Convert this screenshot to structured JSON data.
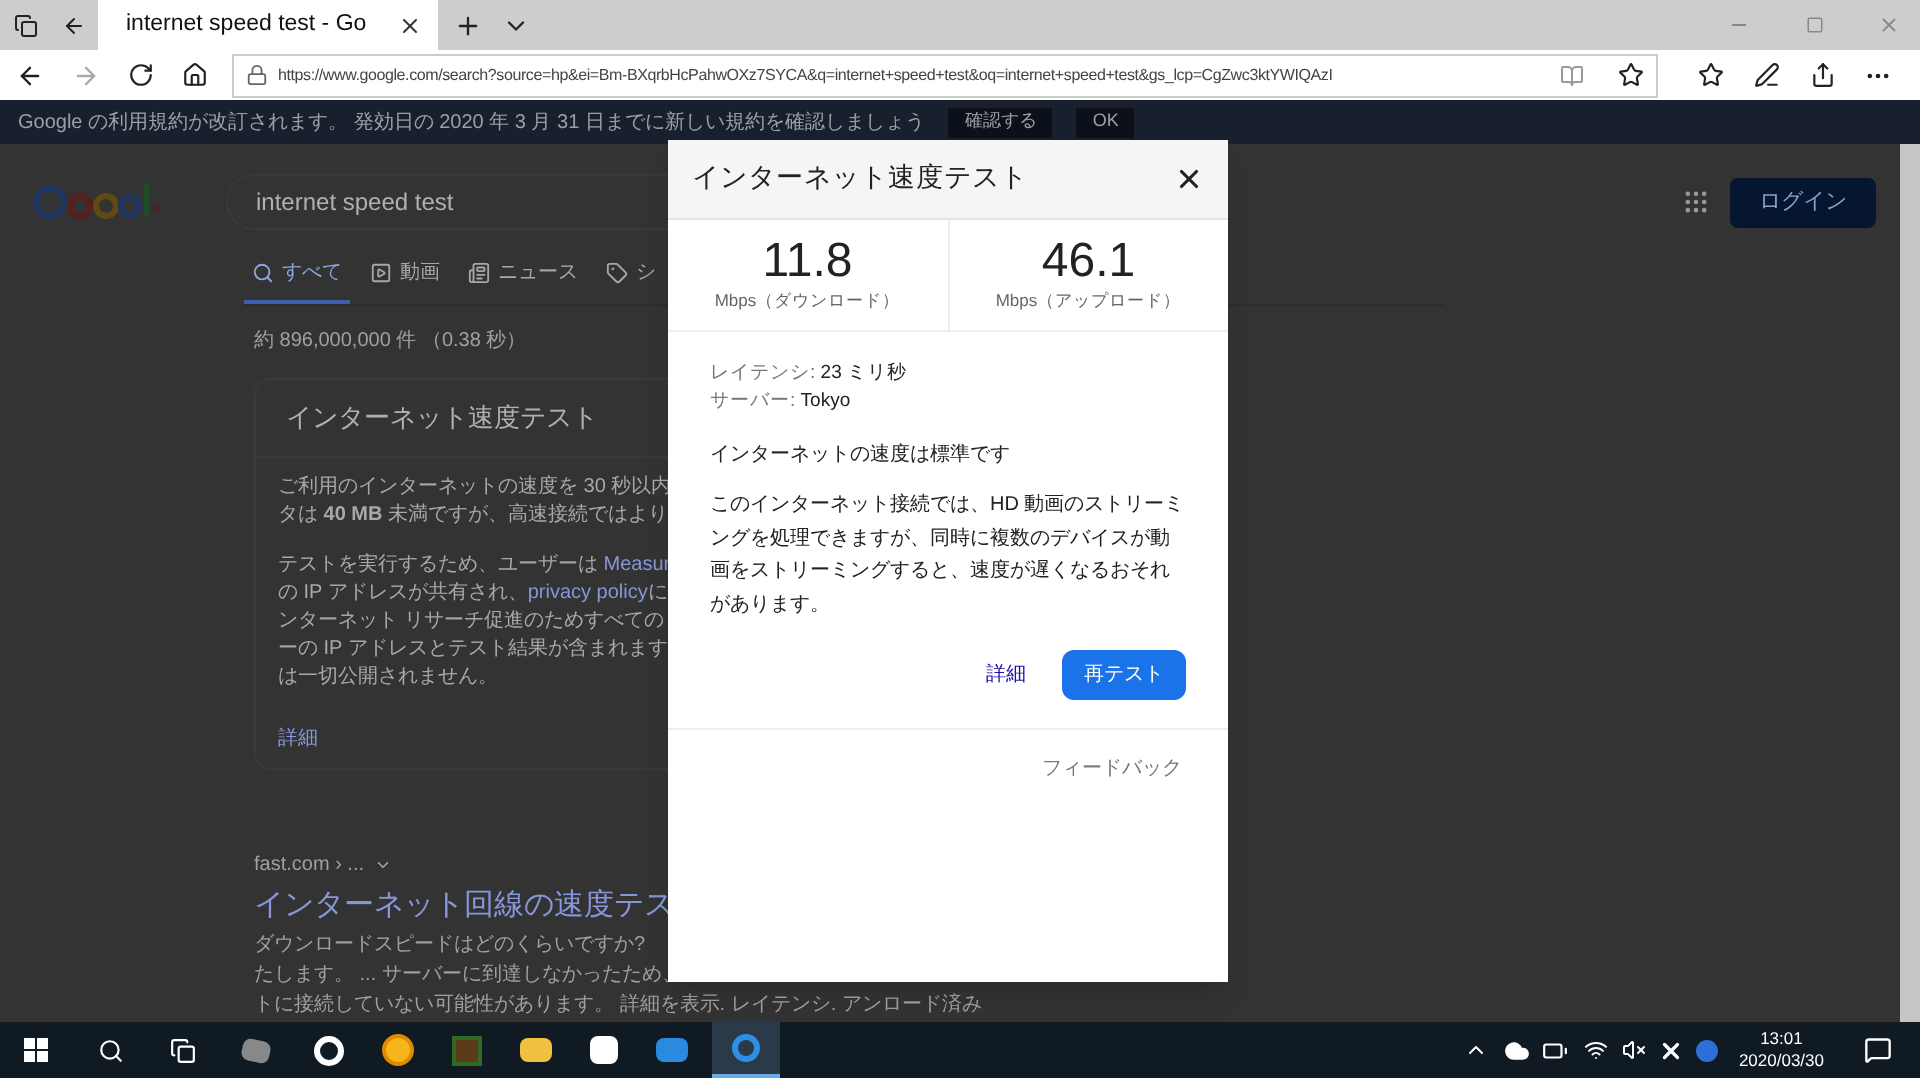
{
  "browser": {
    "tab_title": "internet speed test - Go",
    "url": "https://www.google.com/search?source=hp&ei=Bm-BXqrbHcPahwOXz7SYCA&q=internet+speed+test&oq=internet+speed+test&gs_lcp=CgZwc3ktYWIQAzI"
  },
  "banner": {
    "text": "Google の利用規約が改訂されます。 発効日の 2020 年 3 月 31 日までに新しい規約を確認しましょう",
    "buttons": [
      "確認する",
      "OK"
    ]
  },
  "search": {
    "query": "internet speed test",
    "login": "ログイン"
  },
  "search_tabs": [
    {
      "label": "すべて",
      "selected": true,
      "kind": "search"
    },
    {
      "label": "動画",
      "selected": false,
      "kind": "video"
    },
    {
      "label": "ニュース",
      "selected": false,
      "kind": "news"
    },
    {
      "label": "シ",
      "selected": false,
      "kind": "shopping"
    }
  ],
  "result_stats": "約 896,000,000 件 （0.38 秒）",
  "card": {
    "title": "インターネット速度テスト",
    "paragraphs": [
      [
        [
          {
            "text": "ご利用のインターネットの速度を 30 秒以内"
          }
        ],
        [
          {
            "text": "タは **40 MB** 未満ですが、高速接続ではより"
          }
        ]
      ],
      [
        [
          {
            "text": "テストを実行するため、ユーザーは "
          },
          {
            "text": "Measur",
            "link": true
          }
        ],
        [
          {
            "text": "の IP アドレスが共有され、"
          },
          {
            "text": "privacy policy",
            "link": true
          },
          {
            "text": "に"
          }
        ],
        [
          {
            "text": "ンターネット リサーチ促進のためすべての"
          }
        ],
        [
          {
            "text": "ーの IP アドレスとテスト結果が含まれます"
          }
        ],
        [
          {
            "text": "は一切公開されません。"
          }
        ]
      ]
    ],
    "link": "詳細"
  },
  "result": {
    "breadcrumb": "fast.com › ...",
    "title": "インターネット回線の速度テス",
    "snippet": [
      "ダウンロードスピードはどのくらいですか?",
      "たします。 ... サーバーに到達しなかったため、",
      "トに接続していない可能性があります。 詳細を表示. レイテンシ. アンロード済み"
    ]
  },
  "dialog": {
    "title": "インターネット速度テスト",
    "speeds": [
      {
        "value": "11.8",
        "unit": "Mbps（ダウンロード）"
      },
      {
        "value": "46.1",
        "unit": "Mbps（アップロード）"
      }
    ],
    "details": [
      {
        "label": "レイテンシ:",
        "value": "23 ミリ秒"
      },
      {
        "label": "サーバー:",
        "value": "Tokyo"
      }
    ],
    "status": "インターネットの速度は標準です",
    "description": "このインターネット接続では、HD 動画のストリーミングを処理できますが、同時に複数のデバイスが動画をストリーミングすると、速度が遅くなるおそれがあります。",
    "more_link": "詳細",
    "retest": "再テスト",
    "feedback": "フィードバック"
  },
  "taskbar": {
    "time": "13:01",
    "date": "2020/03/30"
  }
}
